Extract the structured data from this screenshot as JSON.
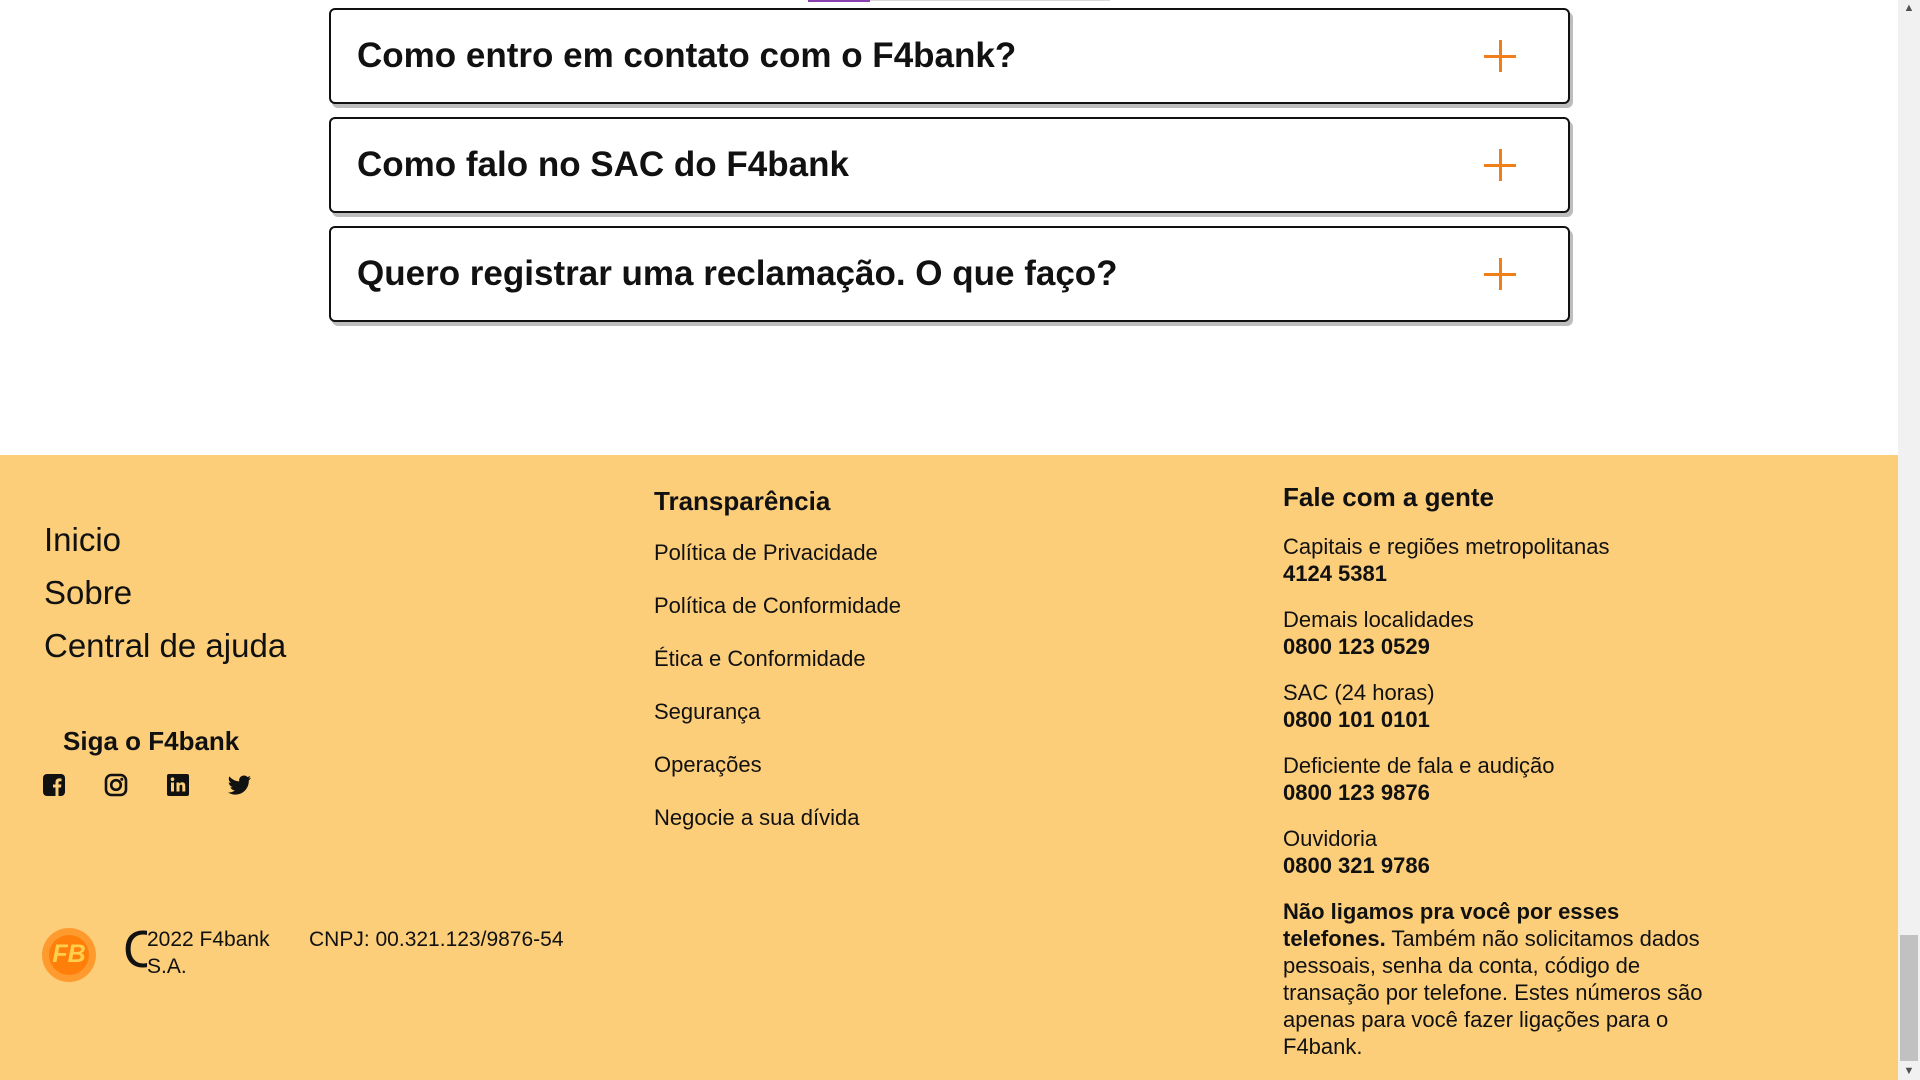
{
  "faq": {
    "items": [
      {
        "question": "Como entro em contato com o F4bank?"
      },
      {
        "question": "Como falo no SAC do F4bank"
      },
      {
        "question": "Quero registrar uma reclamação. O que faço?"
      }
    ]
  },
  "footer": {
    "nav": [
      "Inicio",
      "Sobre",
      "Central de ajuda"
    ],
    "follow_title": "Siga o F4bank",
    "social": [
      "facebook-icon",
      "instagram-icon",
      "linkedin-icon",
      "twitter-icon"
    ],
    "logo_text": "FB",
    "copyright_symbol": "C",
    "copyright": "2022 F4bank S.A.",
    "cnpj": "CNPJ: 00.321.123/9876-54",
    "transparency": {
      "title": "Transparência",
      "links": [
        "Política de Privacidade",
        "Política de Conformidade",
        "Ética e Conformidade",
        "Segurança",
        "Operações",
        "Negocie a sua dívida"
      ]
    },
    "contact": {
      "title": "Fale com a gente",
      "items": [
        {
          "label": "Capitais e regiões metropolitanas",
          "phone": "4124 5381"
        },
        {
          "label": "Demais localidades",
          "phone": "0800 123 0529"
        },
        {
          "label": "SAC (24 horas)",
          "phone": "0800 101 0101"
        },
        {
          "label": "Deficiente de fala e audição",
          "phone": "0800 123 9876"
        },
        {
          "label": "Ouvidoria",
          "phone": "0800 321 9786"
        }
      ],
      "notice_bold": "Não ligamos pra você por esses telefones.",
      "notice_text": "Também não solicitamos dados pessoais, senha da conta, código de transação por telefone. Estes números são apenas para você fazer ligações para o F4bank."
    }
  },
  "colors": {
    "accent": "#f07f1a",
    "footer_bg": "#fcce7a"
  }
}
